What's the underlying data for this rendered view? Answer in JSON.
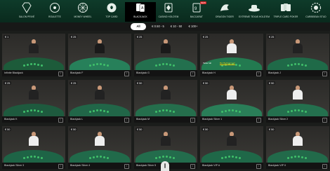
{
  "nav": {
    "items": [
      {
        "label": "Salon Privé",
        "icon": "diamond-icon"
      },
      {
        "label": "Roulette",
        "icon": "roulette-icon"
      },
      {
        "label": "Money Wheel",
        "icon": "wheel-icon"
      },
      {
        "label": "Top Card",
        "icon": "soccer-ball-icon"
      },
      {
        "label": "Blackjack",
        "icon": "cards-icon",
        "active": true
      },
      {
        "label": "Casino Hold'em",
        "icon": "diamond-suit-icon"
      },
      {
        "label": "Baccarat",
        "icon": "baccarat-icon",
        "badge": "NEW"
      },
      {
        "label": "Dragon Tiger",
        "icon": "dragon-icon"
      },
      {
        "label": "Extreme Texas Hold'em",
        "icon": "hat-icon"
      },
      {
        "label": "Triple Card Poker",
        "icon": "poker-icon"
      },
      {
        "label": "Caribbean Stud",
        "icon": "chip-icon"
      }
    ]
  },
  "filters": {
    "all_label": "All",
    "options": [
      "€ 0.50 - 5",
      "€ 10 - 50",
      "€ 100+"
    ]
  },
  "sat_tag": "Table full",
  "bet_tag": "Bet Behind now!",
  "tables": [
    {
      "name": "Infinite Blackjack",
      "price": "€ 1",
      "felt": "#1d5b3a",
      "dealer": "#222"
    },
    {
      "name": "Blackjack F",
      "price": "€ 25",
      "felt": "#27805a",
      "dealer": "#1a1a1a"
    },
    {
      "name": "Blackjack G",
      "price": "€ 25",
      "felt": "#23704e",
      "dealer": "#1a1a1a"
    },
    {
      "name": "Blackjack H",
      "price": "€ 25",
      "felt": "#237a50",
      "dealer": "#eee"
    },
    {
      "name": "Blackjack J",
      "price": "€ 25",
      "felt": "#1f6a48",
      "dealer": "#222"
    },
    {
      "name": "Blackjack K",
      "price": "€ 25",
      "felt": "#1e5a3e",
      "dealer": "#222"
    },
    {
      "name": "Blackjack L",
      "price": "€ 25",
      "felt": "#216648",
      "dealer": "#222"
    },
    {
      "name": "Blackjack M",
      "price": "€ 50",
      "felt": "#256e4c",
      "dealer": "#222"
    },
    {
      "name": "Blackjack Silver 1",
      "price": "€ 50",
      "felt": "#2a7e58",
      "dealer": "#eee"
    },
    {
      "name": "Blackjack Silver 2",
      "price": "€ 50",
      "felt": "#24704e",
      "dealer": "#eee"
    },
    {
      "name": "Blackjack Silver 3",
      "price": "€ 50",
      "felt": "#1e6446",
      "dealer": "#eee"
    },
    {
      "name": "Blackjack Silver 4",
      "price": "€ 50",
      "felt": "#216a4a",
      "dealer": "#eee"
    },
    {
      "name": "Blackjack Silver 5",
      "price": "€ 50",
      "felt": "#236c4c",
      "dealer": "#222"
    },
    {
      "name": "Blackjack VIP A",
      "price": "€ 50",
      "felt": "#1f6848",
      "dealer": "#222"
    },
    {
      "name": "Blackjack VIP X",
      "price": "€ 50",
      "felt": "#226a4a",
      "dealer": "#eee"
    }
  ]
}
